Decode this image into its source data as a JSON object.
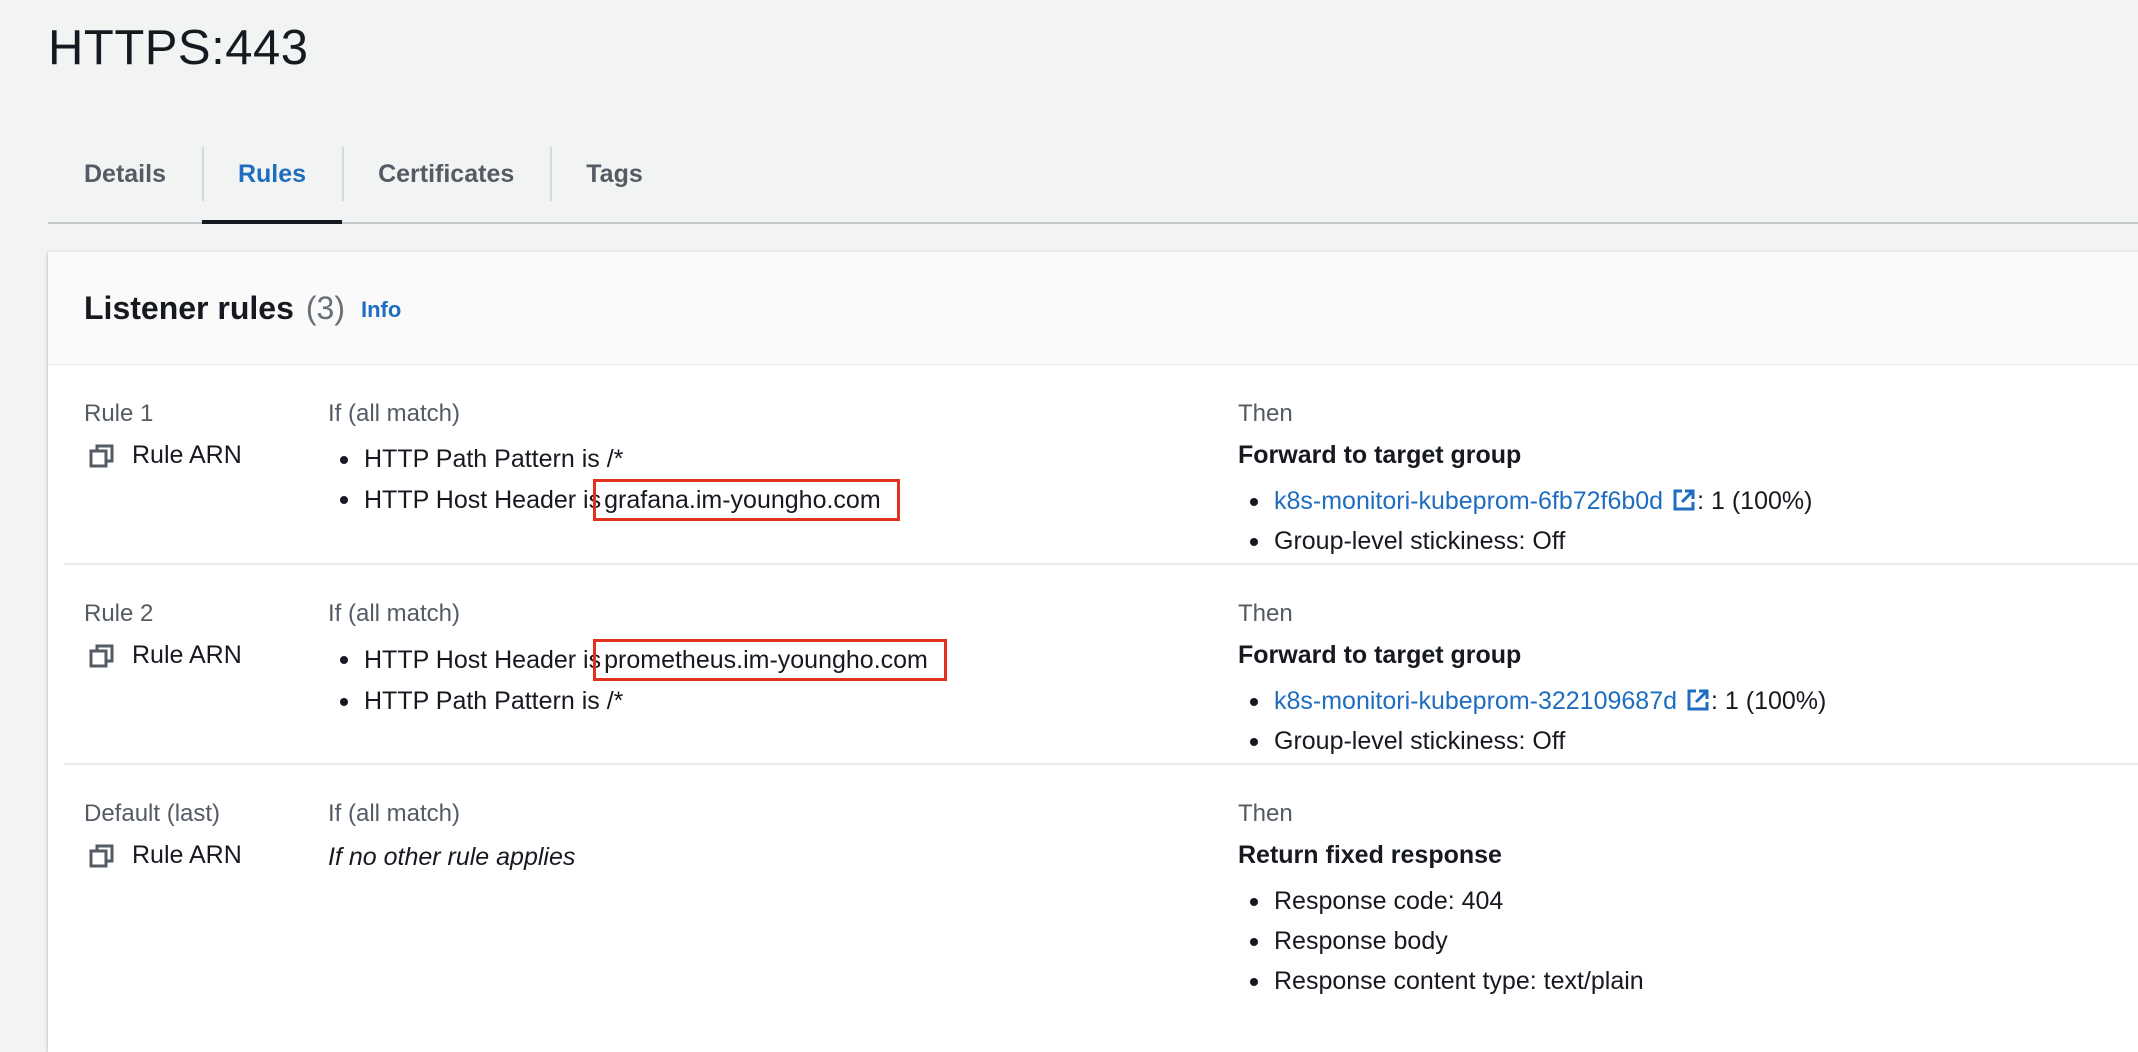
{
  "page": {
    "title": "HTTPS:443"
  },
  "tabs": [
    {
      "label": "Details"
    },
    {
      "label": "Rules"
    },
    {
      "label": "Certificates"
    },
    {
      "label": "Tags"
    }
  ],
  "active_tab": "Rules",
  "listener_rules": {
    "title": "Listener rules",
    "count": "(3)",
    "info": "Info",
    "rules": [
      {
        "name": "Rule 1",
        "arn_label": "Rule ARN",
        "if_label": "If (all match)",
        "conditions": [
          {
            "text": "HTTP Path Pattern is /*",
            "prefix": "",
            "highlight": ""
          },
          {
            "text": "",
            "prefix": "HTTP Host Header is",
            "highlight": "grafana.im-youngho.com"
          }
        ],
        "then_label": "Then",
        "action": "Forward to target group",
        "target_group": "k8s-monitori-kubeprom-6fb72f6b0d",
        "weight": ": 1 (100%)",
        "stickiness": "Group-level stickiness: Off"
      },
      {
        "name": "Rule 2",
        "arn_label": "Rule ARN",
        "if_label": "If (all match)",
        "conditions": [
          {
            "text": "",
            "prefix": "HTTP Host Header is",
            "highlight": "prometheus.im-youngho.com"
          },
          {
            "text": "HTTP Path Pattern is /*",
            "prefix": "",
            "highlight": ""
          }
        ],
        "then_label": "Then",
        "action": "Forward to target group",
        "target_group": "k8s-monitori-kubeprom-322109687d",
        "weight": ": 1 (100%)",
        "stickiness": "Group-level stickiness: Off"
      },
      {
        "name": "Default (last)",
        "arn_label": "Rule ARN",
        "if_label": "If (all match)",
        "default_condition": "If no other rule applies",
        "then_label": "Then",
        "action": "Return fixed response",
        "details": [
          "Response code: 404",
          "Response body",
          "Response content type: text/plain"
        ]
      }
    ]
  },
  "colors": {
    "link": "#1f6dc0",
    "highlight_border": "#e0321f",
    "muted": "#545b64",
    "background": "#f2f3f3"
  }
}
